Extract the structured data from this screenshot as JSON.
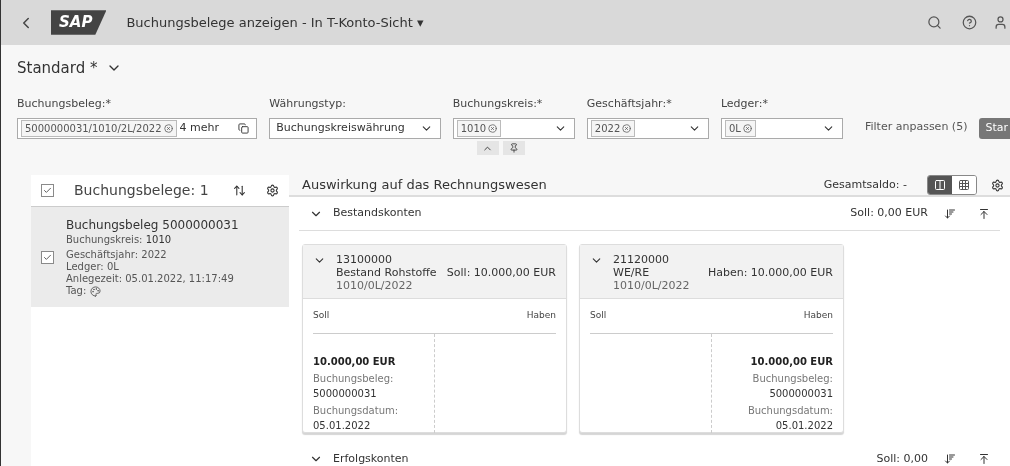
{
  "shell": {
    "logo": "SAP",
    "title": "Buchungsbelege anzeigen - In T-Konto-Sicht ▾"
  },
  "variant": {
    "name": "Standard *"
  },
  "filters": [
    {
      "label": "Buchungsbeleg:*",
      "kind": "multi",
      "tokens": [
        "5000000031/1010/2L/2022"
      ],
      "more": "4 mehr"
    },
    {
      "label": "Währungstyp:",
      "kind": "select",
      "value": "Buchungskreiswährung"
    },
    {
      "label": "Buchungskreis:*",
      "kind": "tokens",
      "tokens": [
        "1010"
      ]
    },
    {
      "label": "Geschäftsjahr:*",
      "kind": "tokens",
      "tokens": [
        "2022"
      ]
    },
    {
      "label": "Ledger:*",
      "kind": "tokens",
      "tokens": [
        "0L"
      ]
    }
  ],
  "filter_bar": {
    "adapt": "Filter anpassen (5)",
    "go": "Star"
  },
  "list": {
    "title": "Buchungsbelege: 1",
    "all_checked": true,
    "items": [
      {
        "title": "Buchungsbeleg 5000000031",
        "selected": true,
        "checked": true,
        "company_label": "Buchungskreis:",
        "company": "1010",
        "lines": [
          "Geschäftsjahr: 2022",
          "Ledger: 0L",
          "Anlegezeit: 05.01.2022, 11:17:49"
        ],
        "tag_label": "Tag:"
      }
    ]
  },
  "main": {
    "title": "Auswirkung auf das Rechnungswesen",
    "total": "Gesamtsaldo: -",
    "view_toggle": [
      {
        "selected": true
      },
      {
        "selected": false
      }
    ],
    "sections": [
      {
        "title": "Bestandskonten",
        "expanded": true,
        "balance": "Soll: 0,00 EUR",
        "cards": [
          {
            "account": "13100000",
            "name": "Bestand Rohstoffe",
            "amount": "Soll: 10.000,00 EUR",
            "key": "1010/0L/2022",
            "debit_head": "Soll",
            "credit_head": "Haben",
            "debit_entries": [
              {
                "amount": "10.000,00 EUR",
                "doc_label": "Buchungsbeleg:",
                "doc": "5000000031",
                "date_label": "Buchungsdatum:",
                "date": "05.01.2022"
              }
            ]
          },
          {
            "account": "21120000",
            "name": "WE/RE",
            "amount": "Haben: 10.000,00 EUR",
            "key": "1010/0L/2022",
            "debit_head": "Soll",
            "credit_head": "Haben",
            "credit_entries": [
              {
                "amount": "10.000,00 EUR",
                "doc_label": "Buchungsbeleg:",
                "doc": "5000000031",
                "date_label": "Buchungsdatum:",
                "date": "05.01.2022"
              }
            ]
          }
        ]
      },
      {
        "title": "Erfolgskonten",
        "expanded": true,
        "balance": "Soll: 0,00"
      }
    ]
  }
}
